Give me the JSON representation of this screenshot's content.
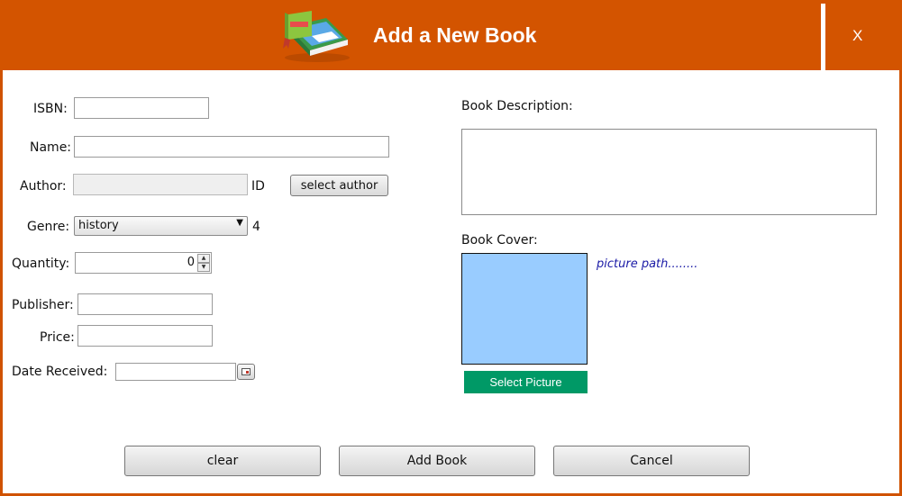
{
  "window": {
    "title": "Add a New Book",
    "close_label": "X"
  },
  "form": {
    "isbn_label": "ISBN:",
    "isbn_value": "",
    "name_label": "Name:",
    "name_value": "",
    "author_label": "Author:",
    "author_value": "",
    "author_id_label": "ID",
    "select_author_label": "select author",
    "genre_label": "Genre:",
    "genre_value": "history",
    "genre_id": "4",
    "quantity_label": "Quantity:",
    "quantity_value": "0",
    "publisher_label": "Publisher:",
    "publisher_value": "",
    "price_label": "Price:",
    "price_value": "",
    "date_label": "Date Received:",
    "date_value": ""
  },
  "description": {
    "label": "Book Description:",
    "value": ""
  },
  "cover": {
    "label": "Book Cover:",
    "path_text": "picture path........",
    "select_label": "Select Picture",
    "preview_color": "#99ccff",
    "select_color": "#009966"
  },
  "actions": {
    "clear_label": "clear",
    "add_label": "Add Book",
    "cancel_label": "Cancel"
  },
  "theme": {
    "header_color": "#d35400",
    "panel_color": "#ffffff"
  }
}
